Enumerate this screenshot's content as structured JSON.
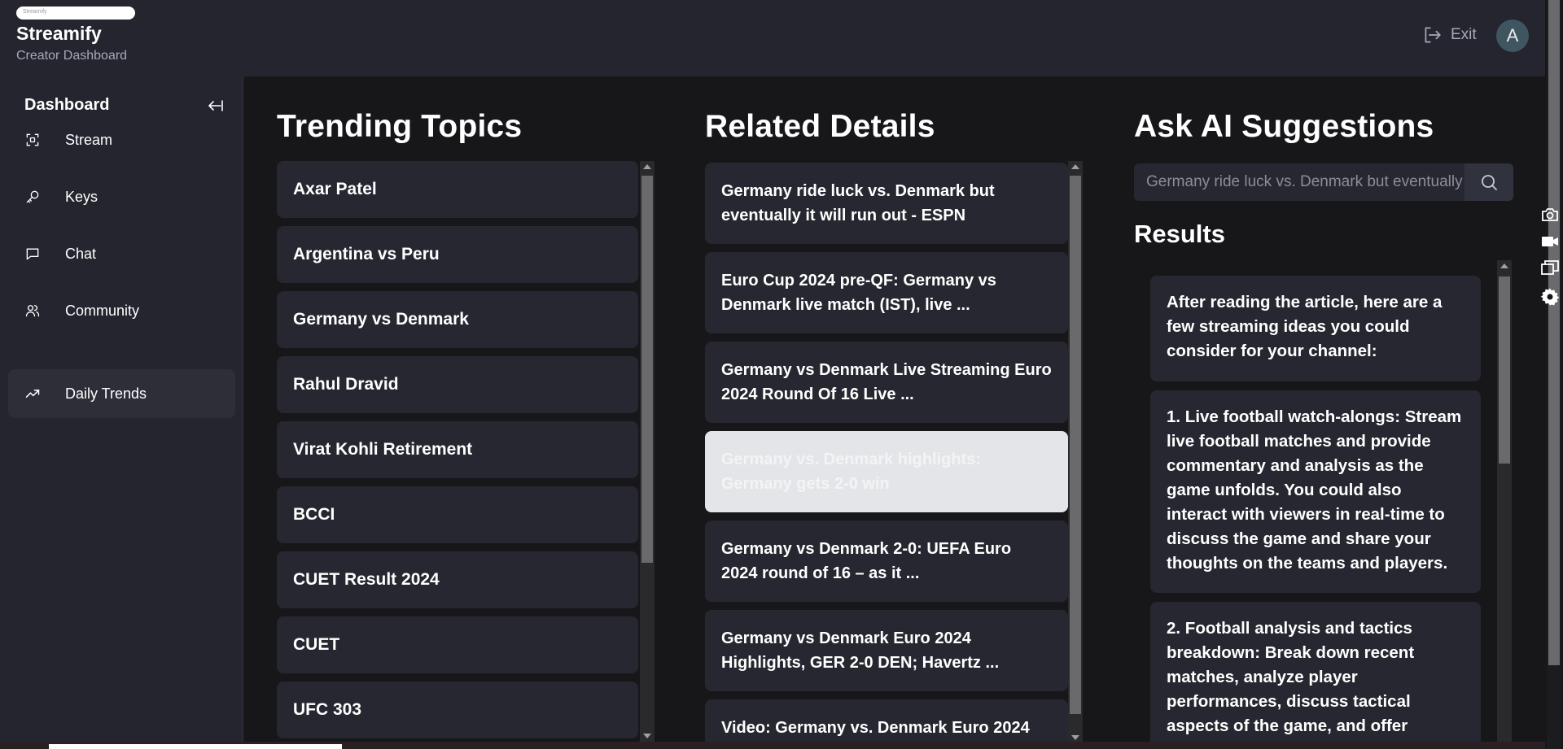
{
  "header": {
    "brand_pill_text": "Streamify",
    "title": "Streamify",
    "subtitle": "Creator Dashboard",
    "exit_label": "Exit",
    "avatar_initial": "A"
  },
  "sidebar": {
    "title": "Dashboard",
    "items": [
      {
        "label": "Stream",
        "icon": "scan-icon"
      },
      {
        "label": "Keys",
        "icon": "key-icon"
      },
      {
        "label": "Chat",
        "icon": "chat-icon"
      },
      {
        "label": "Community",
        "icon": "users-icon"
      },
      {
        "label": "Daily Trends",
        "icon": "trending-icon",
        "active": true
      }
    ]
  },
  "trending": {
    "title": "Trending Topics",
    "topics": [
      "Axar Patel",
      "Argentina vs Peru",
      "Germany vs Denmark",
      "Rahul Dravid",
      "Virat Kohli Retirement",
      "BCCI",
      "CUET Result 2024",
      "CUET",
      "UFC 303"
    ]
  },
  "details": {
    "title": "Related Details",
    "items": [
      "Germany ride luck vs. Denmark but eventually it will run out - ESPN",
      "Euro Cup 2024 pre-QF: Germany vs Denmark live match (IST), live ...",
      "Germany vs Denmark Live Streaming Euro 2024 Round Of 16 Live ...",
      "Germany vs. Denmark highlights: Germany gets 2-0 win",
      "Germany vs Denmark 2-0: UEFA Euro 2024 round of 16 – as it ...",
      "Germany vs Denmark Euro 2024 Highlights, GER 2-0 DEN; Havertz ...",
      "Video: Germany vs. Denmark Euro 2024"
    ],
    "selected_index": 3
  },
  "ai": {
    "title": "Ask AI Suggestions",
    "search_value": "Germany ride luck vs. Denmark but eventually it will run out - ESPN",
    "results_title": "Results",
    "results": [
      "After reading the article, here are a few streaming ideas you could consider for your channel:",
      "1. Live football watch-alongs: Stream live football matches and provide commentary and analysis as the game unfolds. You could also interact with viewers in real-time to discuss the game and share your thoughts on the teams and players.",
      "2. Football analysis and tactics breakdown: Break down recent matches, analyze player performances, discuss tactical aspects of the game, and offer"
    ]
  },
  "toolbar": [
    "camera-icon",
    "video-icon",
    "windows-icon",
    "settings-icon"
  ],
  "colors": {
    "background": "#17171a",
    "panel": "#24252e",
    "card": "#262730",
    "selected_card": "#e4e5e8",
    "muted_text": "#a7a8b4"
  }
}
